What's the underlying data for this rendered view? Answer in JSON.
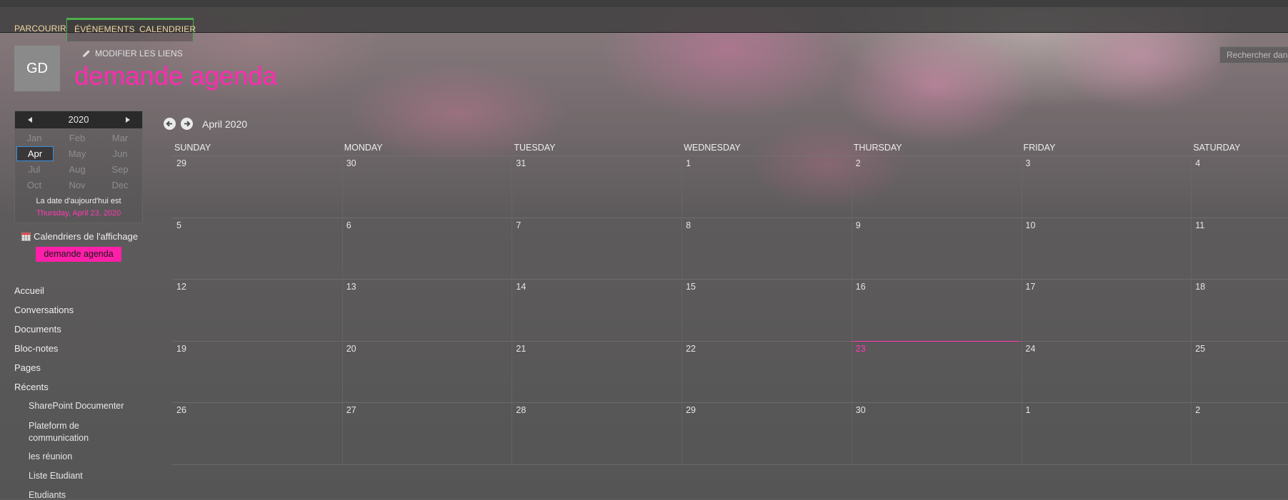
{
  "topnav": {
    "tabs": [
      {
        "label": "PARCOURIR"
      },
      {
        "label": "ÉVÉNEMENTS"
      },
      {
        "label": "CALENDRIER"
      }
    ]
  },
  "search": {
    "placeholder": "Rechercher dans"
  },
  "header": {
    "avatar": "GD",
    "edit_links": "MODIFIER LES LIENS",
    "site_title": "demande agenda"
  },
  "datepicker": {
    "year": "2020",
    "months": [
      "Jan",
      "Feb",
      "Mar",
      "Apr",
      "May",
      "Jun",
      "Jul",
      "Aug",
      "Sep",
      "Oct",
      "Nov",
      "Dec"
    ],
    "selected_month": "Apr",
    "today_label": "La date d'aujourd'hui est",
    "today_value": "Thursday, April 23, 2020"
  },
  "calendars_view": {
    "label": "Calendriers de l'affichage",
    "calendar": "demande agenda"
  },
  "quicklaunch": {
    "items": [
      "Accueil",
      "Conversations",
      "Documents",
      "Bloc-notes",
      "Pages",
      "Récents"
    ],
    "recent": [
      "SharePoint Documenter",
      "Plateform de communication",
      "les réunion",
      "Liste Etudiant",
      "Etudiants"
    ]
  },
  "calendar": {
    "month_title": "April 2020",
    "days": [
      "SUNDAY",
      "MONDAY",
      "TUESDAY",
      "WEDNESDAY",
      "THURSDAY",
      "FRIDAY",
      "SATURDAY"
    ],
    "weeks": [
      [
        "29",
        "30",
        "31",
        "1",
        "2",
        "3",
        "4"
      ],
      [
        "5",
        "6",
        "7",
        "8",
        "9",
        "10",
        "11"
      ],
      [
        "12",
        "13",
        "14",
        "15",
        "16",
        "17",
        "18"
      ],
      [
        "19",
        "20",
        "21",
        "22",
        "23",
        "24",
        "25"
      ],
      [
        "26",
        "27",
        "28",
        "29",
        "30",
        "1",
        "2"
      ]
    ],
    "today": "23"
  },
  "colors": {
    "accent": "#ff2bb0",
    "tab_border": "#4cae4c"
  }
}
